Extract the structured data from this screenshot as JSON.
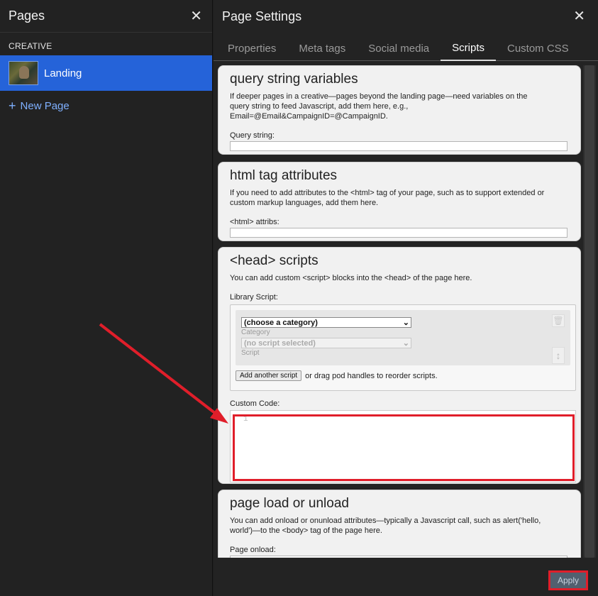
{
  "pages_panel": {
    "title": "Pages",
    "close": "✕",
    "section": "CREATIVE",
    "pages": [
      {
        "name": "Landing"
      }
    ],
    "new_page": "New Page",
    "new_page_icon": "+"
  },
  "settings": {
    "title": "Page Settings",
    "close": "✕",
    "tabs": [
      "Properties",
      "Meta tags",
      "Social media",
      "Scripts",
      "Custom CSS"
    ],
    "active_tab": "Scripts",
    "sections": {
      "query": {
        "title": "query string variables",
        "desc": "If deeper pages in a creative—pages beyond the landing page—need variables on the query string to feed Javascript, add them here, e.g., Email=@Email&CampaignID=@CampaignID.",
        "label": "Query string:"
      },
      "html_attr": {
        "title": "html tag attributes",
        "desc": "If you need to add attributes to the <html> tag of your page, such as to support extended or custom markup languages, add them here.",
        "label": "<html> attribs:"
      },
      "head": {
        "title": "<head> scripts",
        "desc": "You can add custom <script> blocks into the <head> of the page here.",
        "library_label": "Library Script:",
        "category_select": "(choose a category)",
        "category_label": "Category",
        "script_select": "(no script selected)",
        "script_label": "Script",
        "add_button": "Add another script",
        "add_hint": "or drag pod handles to reorder scripts.",
        "custom_label": "Custom Code:",
        "line_number": "1"
      },
      "load": {
        "title": "page load or unload",
        "desc": "You can add onload or onunload attributes—typically a Javascript call, such as alert('hello, world')—to the <body> tag of the page here.",
        "label": "Page onload:"
      }
    },
    "apply": "Apply"
  },
  "colors": {
    "accent": "#2563d9",
    "annotation": "#e01e2a",
    "apply_bg": "#51606f"
  }
}
